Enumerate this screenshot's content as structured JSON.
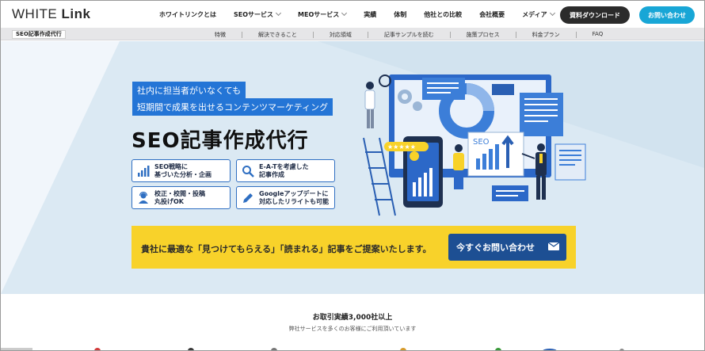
{
  "header": {
    "logo_light": "WHITE ",
    "logo_bold": "Link",
    "nav": [
      {
        "label": "ホワイトリンクとは",
        "dropdown": false
      },
      {
        "label": "SEOサービス",
        "dropdown": true
      },
      {
        "label": "MEOサービス",
        "dropdown": true
      },
      {
        "label": "実績",
        "dropdown": false
      },
      {
        "label": "体制",
        "dropdown": false
      },
      {
        "label": "他社との比較",
        "dropdown": false
      },
      {
        "label": "会社概要",
        "dropdown": false
      },
      {
        "label": "メディア",
        "dropdown": true
      }
    ],
    "download_label": "資料ダウンロード",
    "contact_label": "お問い合わせ"
  },
  "subnav": {
    "title": "SEO記事作成代行",
    "links": [
      "特徴",
      "解決できること",
      "対応領域",
      "記事サンプルを読む",
      "施策プロセス",
      "料金プラン",
      "FAQ"
    ]
  },
  "hero": {
    "tagline1": "社内に担当者がいなくても",
    "tagline2": "短期間で成果を出せるコンテンツマーケティング",
    "headline": "SEO記事作成代行",
    "features": [
      {
        "line1": "SEO戦略に",
        "line2": "基づいた分析・企画",
        "icon": "bar-chart-icon"
      },
      {
        "line1": "E-A-Tを考慮した",
        "line2": "記事作成",
        "icon": "magnifier-icon"
      },
      {
        "line1": "校正・校閲・投稿",
        "line2": "丸投げOK",
        "icon": "support-person-icon"
      },
      {
        "line1": "Googleアップデートに",
        "line2": "対応したリライトも可能",
        "icon": "pencil-icon"
      }
    ],
    "illustration_seo_label": "SEO",
    "cta_text": "貴社に最適な「見つけてもらえる」「読まれる」記事をご提案いたします。",
    "cta_button": "今すぐお問い合わせ"
  },
  "clients": {
    "title": "お取引実績3,000社以上",
    "subtitle": "弊社サービスを多くのお客様にご利用頂いています"
  },
  "colors": {
    "accent_blue": "#2475d6",
    "cta_yellow": "#f8d22a",
    "cta_button": "#1d4f93",
    "contact_button": "#18a6d6"
  }
}
